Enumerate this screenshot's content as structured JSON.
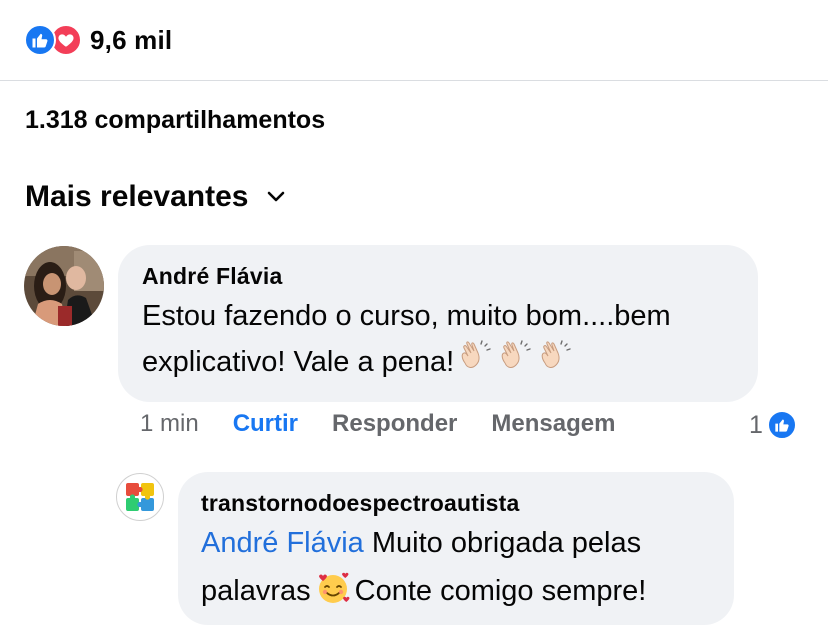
{
  "reactions": {
    "count": "9,6 mil",
    "icons": [
      "like-icon",
      "love-icon"
    ],
    "colors": {
      "like": "#1877f2",
      "love": "#f33e58"
    }
  },
  "shares": {
    "text": "1.318 compartilhamentos"
  },
  "sort": {
    "label": "Mais relevantes",
    "icon": "chevron-down-icon"
  },
  "comments": [
    {
      "author": "André Flávia",
      "text_line1": "Estou fazendo o curso, muito bom....bem",
      "text_line2": "explicativo! Vale a pena!",
      "emojis": [
        "clapping-hands",
        "clapping-hands",
        "clapping-hands"
      ],
      "actions": {
        "time": "1 min",
        "like": "Curtir",
        "reply": "Responder",
        "message": "Mensagem"
      },
      "like_count": "1",
      "replies": [
        {
          "author": "transtornodoespectroautista",
          "mention": "André Flávia",
          "text_part1": "Muito obrigada pelas",
          "text_part2": "palavras",
          "emoji": "smiling-face-with-hearts",
          "text_part3": "Conte comigo sempre!"
        }
      ]
    }
  ]
}
